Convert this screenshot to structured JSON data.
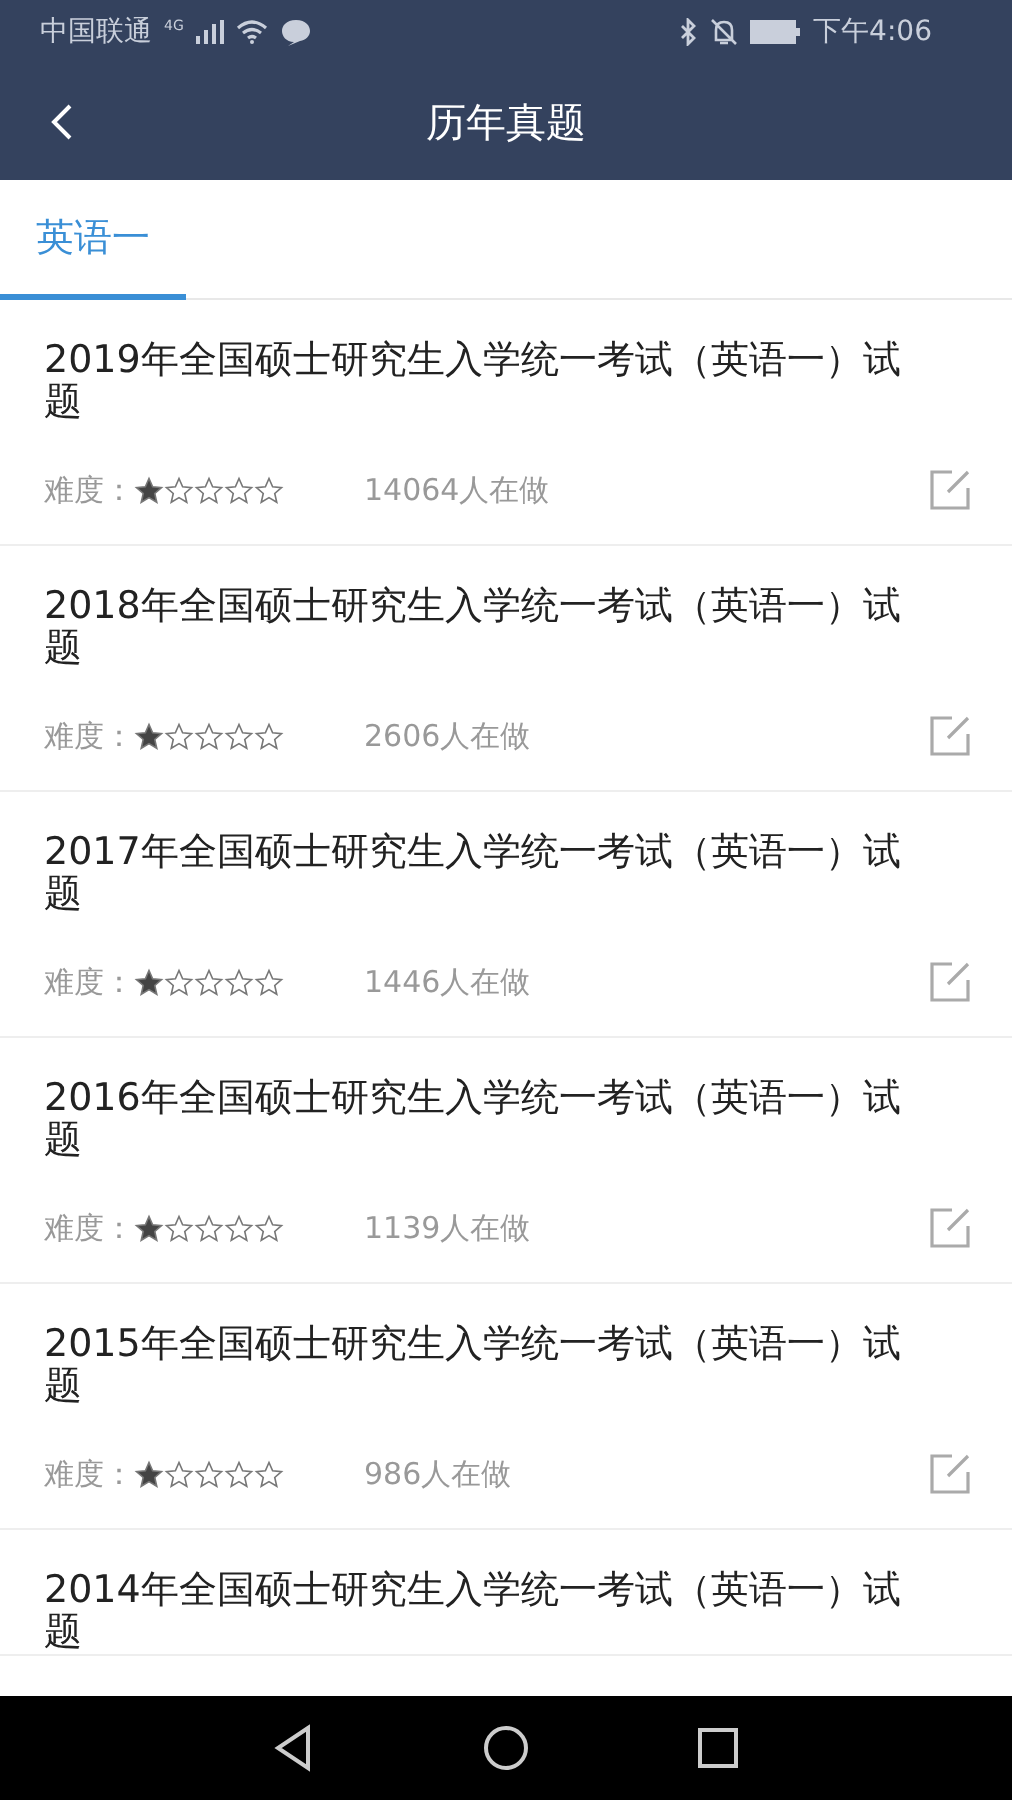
{
  "status_bar": {
    "carrier": "中国联通",
    "network": "4G",
    "time": "下午4:06"
  },
  "app_bar": {
    "title": "历年真题"
  },
  "tabs": [
    {
      "label": "英语一",
      "selected": true
    }
  ],
  "papers": [
    {
      "title": "2019年全国硕士研究生入学统一考试（英语一）试题",
      "difficulty_label": "难度：",
      "stars": 1,
      "participants": "14064人在做"
    },
    {
      "title": "2018年全国硕士研究生入学统一考试（英语一）试题",
      "difficulty_label": "难度：",
      "stars": 1,
      "participants": "2606人在做"
    },
    {
      "title": "2017年全国硕士研究生入学统一考试（英语一）试题",
      "difficulty_label": "难度：",
      "stars": 1,
      "participants": "1446人在做"
    },
    {
      "title": "2016年全国硕士研究生入学统一考试（英语一）试题",
      "difficulty_label": "难度：",
      "stars": 1,
      "participants": "1139人在做"
    },
    {
      "title": "2015年全国硕士研究生入学统一考试（英语一）试题",
      "difficulty_label": "难度：",
      "stars": 1,
      "participants": "986人在做"
    },
    {
      "title": "2014年全国硕士研究生入学统一考试（英语一）试题"
    }
  ]
}
